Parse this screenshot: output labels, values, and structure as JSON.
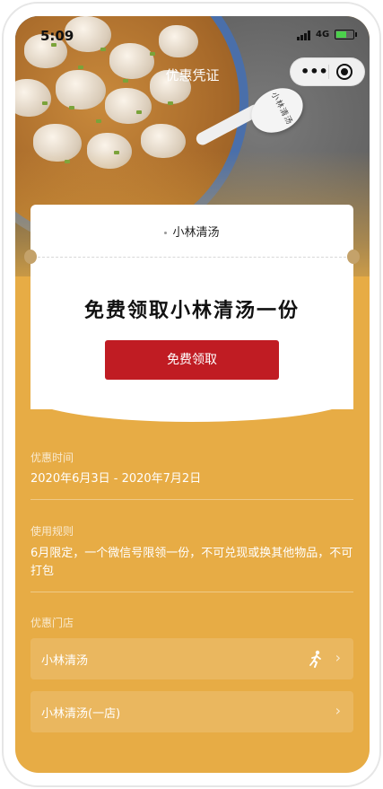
{
  "status_bar": {
    "time": "5:09",
    "network": "4G"
  },
  "nav": {
    "title": "优惠凭证",
    "more_icon": "more-dots-icon",
    "close_icon": "capsule-close-icon"
  },
  "coupon": {
    "store_name": "小林清汤",
    "title": "免费领取小林清汤一份",
    "claim_button": "免费领取"
  },
  "details": {
    "validity_label": "优惠时间",
    "validity_value": "2020年6月3日 - 2020年7月2日",
    "rules_label": "使用规则",
    "rules_value": "6月限定，一个微信号限领一份，不可兑现或换其他物品，不可打包",
    "stores_label": "优惠门店"
  },
  "stores": [
    {
      "name": "小林清汤",
      "icon": "walking-person-icon"
    },
    {
      "name": "小林清汤(一店)"
    }
  ],
  "colors": {
    "background": "#e7ac45",
    "button": "#c01c23",
    "card": "#ffffff"
  }
}
